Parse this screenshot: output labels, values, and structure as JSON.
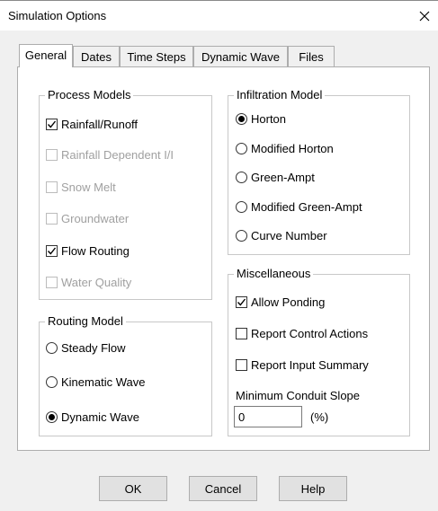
{
  "window": {
    "title": "Simulation Options",
    "close_icon": "close-icon"
  },
  "tabs": [
    {
      "label": "General",
      "active": true
    },
    {
      "label": "Dates"
    },
    {
      "label": "Time Steps"
    },
    {
      "label": "Dynamic Wave"
    },
    {
      "label": "Files"
    }
  ],
  "process_models": {
    "legend": "Process Models",
    "items": [
      {
        "label": "Rainfall/Runoff",
        "checked": true,
        "enabled": true
      },
      {
        "label": "Rainfall Dependent I/I",
        "checked": false,
        "enabled": false
      },
      {
        "label": "Snow Melt",
        "checked": false,
        "enabled": false
      },
      {
        "label": "Groundwater",
        "checked": false,
        "enabled": false
      },
      {
        "label": "Flow Routing",
        "checked": true,
        "enabled": true
      },
      {
        "label": "Water Quality",
        "checked": false,
        "enabled": false
      }
    ]
  },
  "routing_model": {
    "legend": "Routing Model",
    "items": [
      {
        "label": "Steady Flow",
        "selected": false
      },
      {
        "label": "Kinematic Wave",
        "selected": false
      },
      {
        "label": "Dynamic Wave",
        "selected": true
      }
    ]
  },
  "infiltration_model": {
    "legend": "Infiltration Model",
    "items": [
      {
        "label": "Horton",
        "selected": true
      },
      {
        "label": "Modified Horton",
        "selected": false
      },
      {
        "label": "Green-Ampt",
        "selected": false
      },
      {
        "label": "Modified Green-Ampt",
        "selected": false
      },
      {
        "label": "Curve Number",
        "selected": false
      }
    ]
  },
  "miscellaneous": {
    "legend": "Miscellaneous",
    "items": [
      {
        "label": "Allow Ponding",
        "checked": true
      },
      {
        "label": "Report Control Actions",
        "checked": false
      },
      {
        "label": "Report Input Summary",
        "checked": false
      }
    ],
    "min_slope_label": "Minimum Conduit Slope",
    "min_slope_value": "0",
    "min_slope_unit": "(%)"
  },
  "buttons": {
    "ok": "OK",
    "cancel": "Cancel",
    "help": "Help"
  }
}
